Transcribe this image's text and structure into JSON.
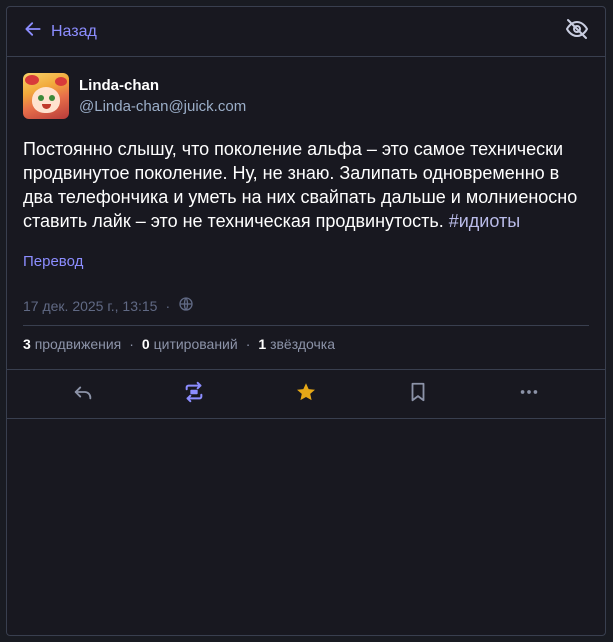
{
  "header": {
    "back_label": "Назад",
    "back_icon": "arrow-left-icon",
    "visibility_icon": "eye-off-icon"
  },
  "status": {
    "display_name": "Linda-chan",
    "acct": "@Linda-chan@juick.com",
    "text": "Постоянно слышу, что поколение альфа – это самое технически продвинутое поколение. Ну, не знаю. Залипать одновременно в два телефончика и уметь на них свайпать дальше и молниеносно ставить лайк – это не техническая продвинутость. ",
    "hashtag": "#идиоты",
    "translate_label": "Перевод",
    "timestamp": "17 дек. 2025 г., 13:15",
    "visibility_dot": "·",
    "boosts_count": "3",
    "boosts_label": "продвижения",
    "quotes_count": "0",
    "quotes_label": "цитирований",
    "favs_count": "1",
    "favs_label": "звёздочка",
    "separator": "·"
  },
  "colors": {
    "accent": "#8c8dff",
    "star": "#ca8f04",
    "background": "#181820",
    "border": "#393f4f"
  },
  "actions": [
    "reply-icon",
    "boost-icon",
    "star-icon",
    "bookmark-icon",
    "more-icon"
  ]
}
